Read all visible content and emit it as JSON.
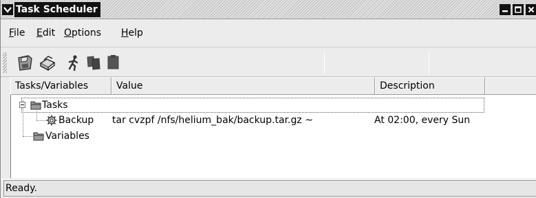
{
  "window": {
    "title": "Task Scheduler"
  },
  "menu": {
    "items": [
      {
        "label": "File",
        "mnemonic": "F",
        "rest": "ile"
      },
      {
        "label": "Edit",
        "mnemonic": "E",
        "rest": "dit"
      },
      {
        "label": "Options",
        "mnemonic": "O",
        "rest": "ptions"
      },
      {
        "label": "Help",
        "mnemonic": "H",
        "rest": "elp"
      }
    ]
  },
  "toolbar": {
    "icons": [
      "save-icon",
      "print-icon",
      "run-icon",
      "copy-icon",
      "paste-icon"
    ]
  },
  "table": {
    "headers": [
      "Tasks/Variables",
      "Value",
      "Description"
    ],
    "rows": [
      {
        "name": "Tasks",
        "value": "",
        "description": "",
        "icon": "folder-icon",
        "level": 0
      },
      {
        "name": "Backup",
        "value": "tar cvzpf /nfs/helium_bak/backup.tar.gz ~",
        "description": "At 02:00, every Sun",
        "icon": "gear-icon",
        "level": 1
      },
      {
        "name": "Variables",
        "value": "",
        "description": "",
        "icon": "folder-icon",
        "level": 0
      }
    ]
  },
  "status": {
    "text": "Ready."
  }
}
